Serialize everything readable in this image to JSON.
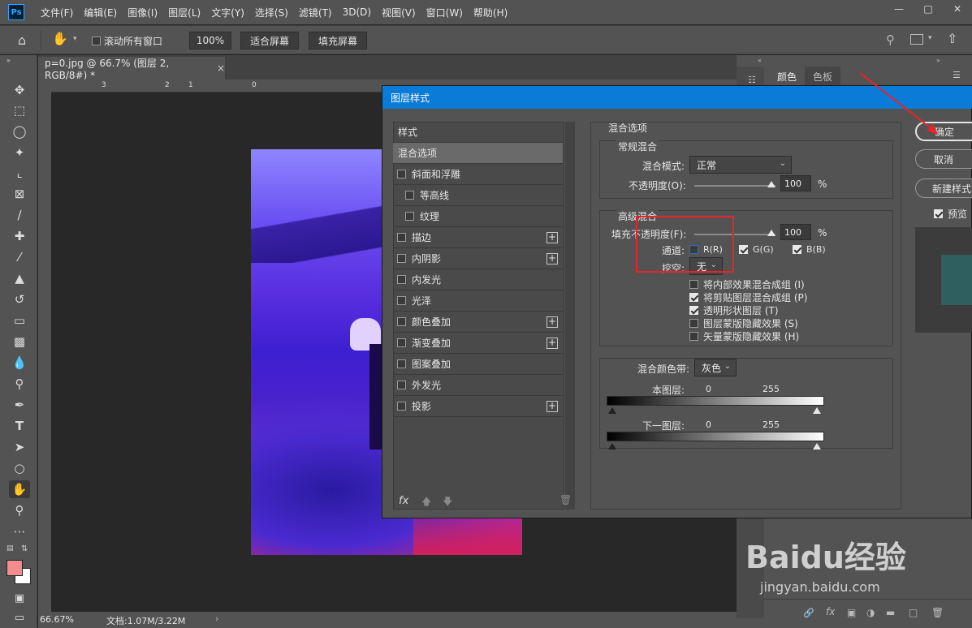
{
  "menubar": {
    "logo": "Ps",
    "items": [
      "文件(F)",
      "编辑(E)",
      "图像(I)",
      "图层(L)",
      "文字(Y)",
      "选择(S)",
      "滤镜(T)",
      "3D(D)",
      "视图(V)",
      "窗口(W)",
      "帮助(H)"
    ]
  },
  "options": {
    "scroll_all": "滚动所有窗口",
    "zoom": "100%",
    "fit_screen": "适合屏幕",
    "fill_screen": "填充屏幕"
  },
  "document": {
    "tab_title": "p=0.jpg @ 66.7% (图层 2, RGB/8#) *",
    "ruler_marks": [
      "3",
      "2",
      "1",
      "0"
    ],
    "zoom_status": "66.67%",
    "doc_status": "文档:1.07M/3.22M"
  },
  "panels": {
    "tab_color": "颜色",
    "tab_swatches": "色板"
  },
  "dialog": {
    "title": "图层样式",
    "styles": [
      {
        "label": "样式",
        "checkbox": false,
        "plus": false,
        "indent": false
      },
      {
        "label": "混合选项",
        "checkbox": false,
        "plus": false,
        "indent": false,
        "selected": true
      },
      {
        "label": "斜面和浮雕",
        "checkbox": true,
        "plus": false,
        "indent": false
      },
      {
        "label": "等高线",
        "checkbox": true,
        "plus": false,
        "indent": true
      },
      {
        "label": "纹理",
        "checkbox": true,
        "plus": false,
        "indent": true
      },
      {
        "label": "描边",
        "checkbox": true,
        "plus": true,
        "indent": false
      },
      {
        "label": "内阴影",
        "checkbox": true,
        "plus": true,
        "indent": false
      },
      {
        "label": "内发光",
        "checkbox": true,
        "plus": false,
        "indent": false
      },
      {
        "label": "光泽",
        "checkbox": true,
        "plus": false,
        "indent": false
      },
      {
        "label": "颜色叠加",
        "checkbox": true,
        "plus": true,
        "indent": false
      },
      {
        "label": "渐变叠加",
        "checkbox": true,
        "plus": true,
        "indent": false
      },
      {
        "label": "图案叠加",
        "checkbox": true,
        "plus": false,
        "indent": false
      },
      {
        "label": "外发光",
        "checkbox": true,
        "plus": false,
        "indent": false
      },
      {
        "label": "投影",
        "checkbox": true,
        "plus": true,
        "indent": false
      }
    ],
    "fx_label": "fx",
    "blend_options_title": "混合选项",
    "general_title": "常规混合",
    "blend_mode_label": "混合模式:",
    "blend_mode_value": "正常",
    "opacity_label": "不透明度(O):",
    "opacity_value": "100",
    "percent": "%",
    "advanced_title": "高级混合",
    "fill_opacity_label": "填充不透明度(F):",
    "fill_opacity_value": "100",
    "channels_label": "通道:",
    "channel_r": "R(R)",
    "channel_g": "G(G)",
    "channel_b": "B(B)",
    "knockout_label": "挖空:",
    "knockout_value": "无",
    "options": [
      {
        "label": "将内部效果混合成组 (I)",
        "checked": false
      },
      {
        "label": "将剪贴图层混合成组 (P)",
        "checked": true
      },
      {
        "label": "透明形状图层 (T)",
        "checked": true
      },
      {
        "label": "图层蒙版隐藏效果 (S)",
        "checked": false
      },
      {
        "label": "矢量蒙版隐藏效果 (H)",
        "checked": false
      }
    ],
    "blend_if_label": "混合颜色带:",
    "blend_if_value": "灰色",
    "this_layer_label": "本图层:",
    "underlying_label": "下一图层:",
    "range_min": "0",
    "range_max": "255",
    "ok_button": "确定",
    "cancel_button": "取消",
    "new_style_button": "新建样式",
    "preview_label": "预览"
  },
  "watermark": {
    "text": "Baidu经验",
    "url": "jingyan.baidu.com"
  },
  "colors": {
    "accent": "#0a7bd6",
    "annotation": "#e8242a"
  }
}
